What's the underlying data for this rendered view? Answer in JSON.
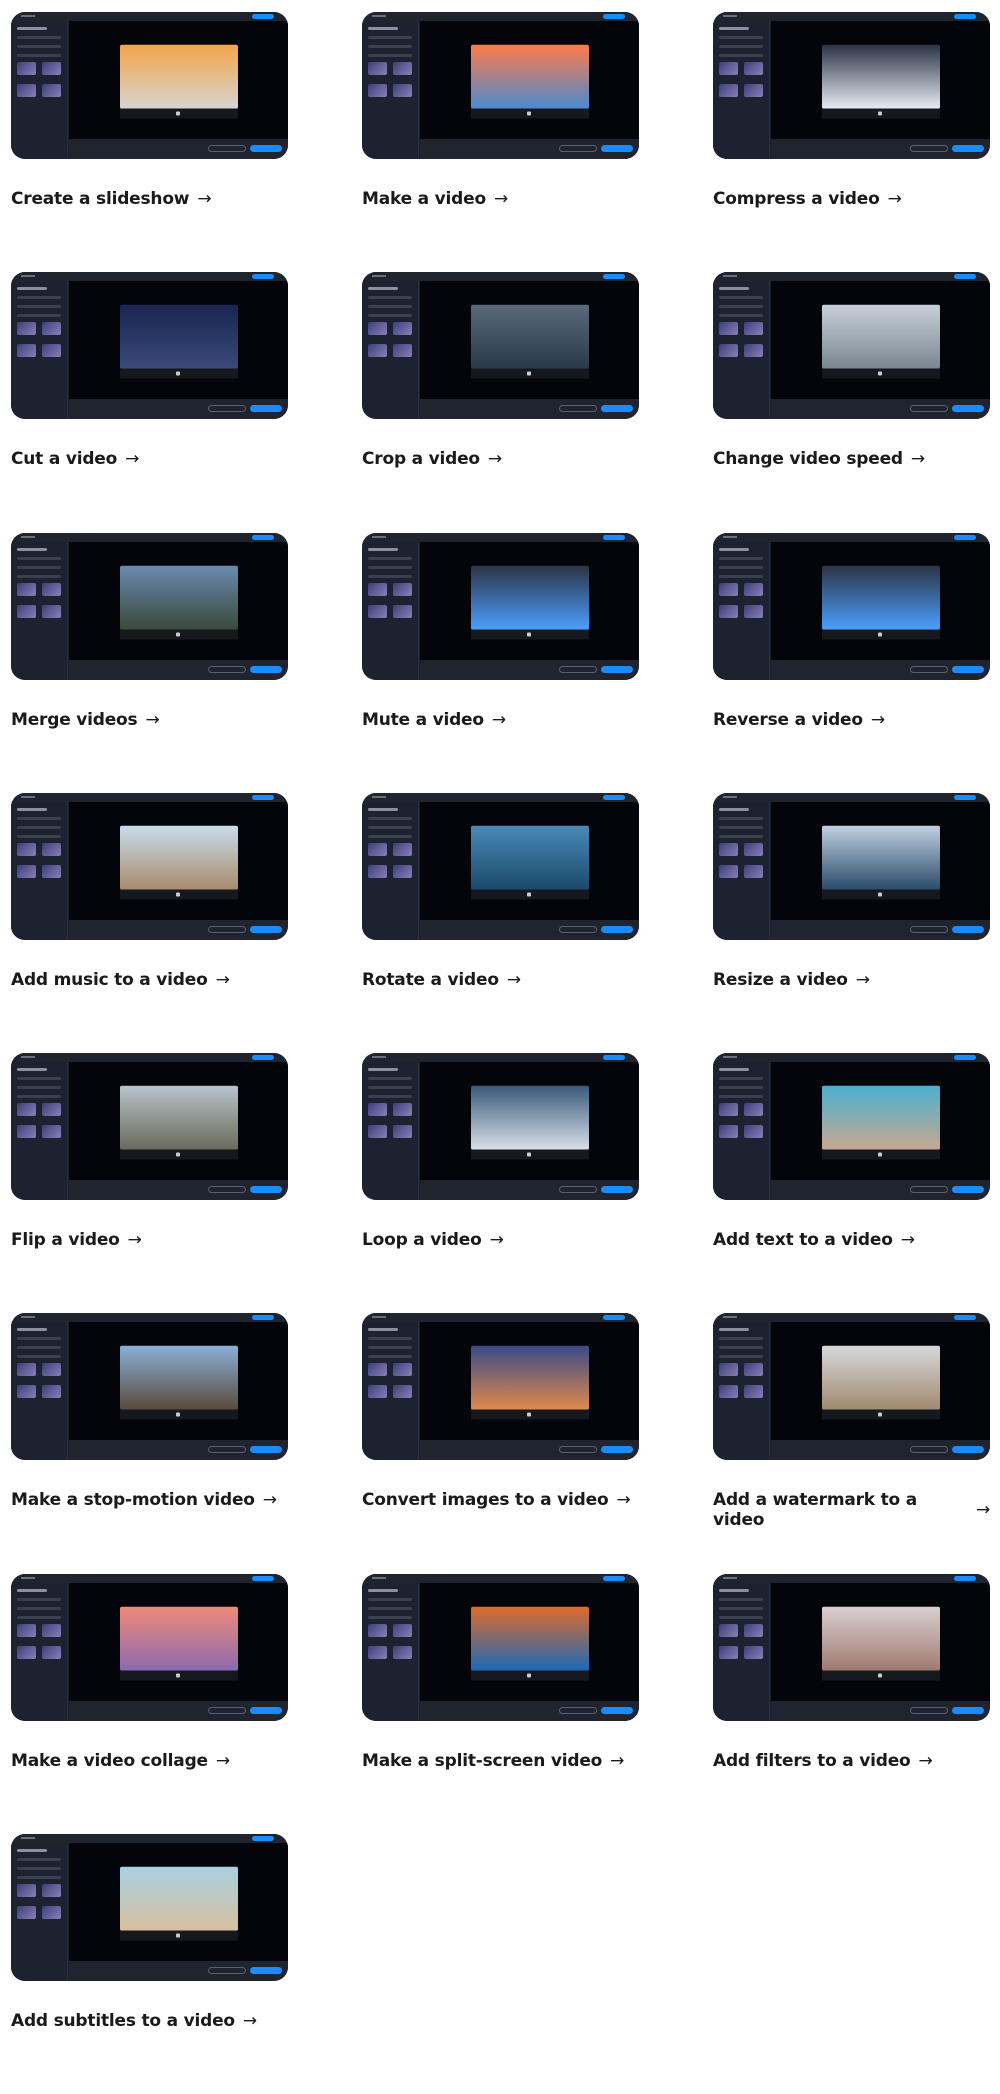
{
  "arrow_icon": "→",
  "accent_color": "#1a8cff",
  "tools": [
    {
      "label": "Create a slideshow",
      "preview": [
        "#f2a54a",
        "#d8d4d0"
      ]
    },
    {
      "label": "Make a video",
      "preview": [
        "#ff7a4a",
        "#4a8ad0"
      ]
    },
    {
      "label": "Compress a video",
      "preview": [
        "#2b3345",
        "#e8ecf4"
      ]
    },
    {
      "label": "Cut a video",
      "preview": [
        "#1a2550",
        "#3a4a7a"
      ]
    },
    {
      "label": "Crop a video",
      "preview": [
        "#5a6a7a",
        "#2a3a4a"
      ]
    },
    {
      "label": "Change video speed",
      "preview": [
        "#c8d0d8",
        "#7a8690"
      ]
    },
    {
      "label": "Merge videos",
      "preview": [
        "#6a8ab0",
        "#3a4a3a"
      ]
    },
    {
      "label": "Mute a video",
      "preview": [
        "#2b3345",
        "#4aa0ff"
      ]
    },
    {
      "label": "Reverse a video",
      "preview": [
        "#2b3345",
        "#4aa0ff"
      ]
    },
    {
      "label": "Add music to a video",
      "preview": [
        "#c8dcec",
        "#a88a6a"
      ]
    },
    {
      "label": "Rotate a video",
      "preview": [
        "#4a8ab8",
        "#1a4a6a"
      ]
    },
    {
      "label": "Resize a video",
      "preview": [
        "#c0d0e0",
        "#2a4a6a"
      ]
    },
    {
      "label": "Flip a video",
      "preview": [
        "#b8c4cc",
        "#6a6a5a"
      ]
    },
    {
      "label": "Loop a video",
      "preview": [
        "#3a5a7a",
        "#d8e0e8"
      ]
    },
    {
      "label": "Add text to a video",
      "preview": [
        "#4ab0d0",
        "#c8a890"
      ]
    },
    {
      "label": "Make a stop-motion video",
      "preview": [
        "#8ab0d8",
        "#5a4a3a"
      ]
    },
    {
      "label": "Convert images to a video",
      "preview": [
        "#3a4a8a",
        "#e08a4a"
      ]
    },
    {
      "label": "Add a watermark to a video",
      "preview": [
        "#d8d8d8",
        "#a08a70"
      ]
    },
    {
      "label": "Make a video collage",
      "preview": [
        "#f08a7a",
        "#8a6ab0"
      ]
    },
    {
      "label": "Make a split-screen video",
      "preview": [
        "#e06a2a",
        "#1a6ab8"
      ]
    },
    {
      "label": "Add filters to a video",
      "preview": [
        "#d8d0d0",
        "#a07a70"
      ]
    },
    {
      "label": "Add subtitles to a video",
      "preview": [
        "#a8d0e0",
        "#d8c0a0"
      ]
    }
  ]
}
